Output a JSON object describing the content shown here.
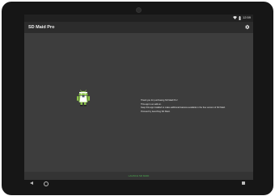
{
  "status_bar": {
    "time": "12:59"
  },
  "app_bar": {
    "title": "SD Maid Pro",
    "settings_icon": "settings-gear-icon"
  },
  "main": {
    "mascot_icon": "sd-maid-android-mascot-icon",
    "messages": [
      "Thank you for purchasing SD Maid Pro!",
      "This app is an add-on.",
      "Keep this app installed to make additional features available in the free version of SD Maid.",
      "Proceed by launching SD Maid."
    ]
  },
  "launch_bar": {
    "button_label": "LAUNCH SD MAID"
  },
  "colors": {
    "accent": "#4caf50",
    "appbar": "#2c2c2c",
    "content_background": "#3d3d3d"
  }
}
